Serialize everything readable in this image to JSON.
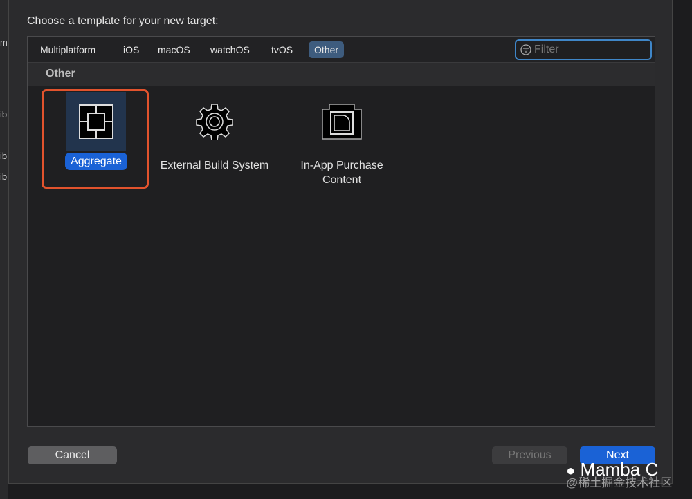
{
  "background_fragments": [
    "m",
    "ib",
    "ib",
    "ib"
  ],
  "dialog": {
    "title": "Choose a template for your new target:",
    "tabs": [
      {
        "label": "Multiplatform"
      },
      {
        "label": "iOS"
      },
      {
        "label": "macOS"
      },
      {
        "label": "watchOS"
      },
      {
        "label": "tvOS"
      },
      {
        "label": "Other",
        "active": true
      }
    ],
    "filter": {
      "placeholder": "Filter",
      "value": ""
    },
    "section_title": "Other",
    "templates": [
      {
        "label": "Aggregate",
        "icon": "aggregate-icon",
        "selected": true
      },
      {
        "label": "External Build System",
        "icon": "gear-icon"
      },
      {
        "label": "In-App Purchase Content",
        "icon": "in-app-purchase-icon"
      }
    ],
    "buttons": {
      "cancel": "Cancel",
      "previous": "Previous",
      "next": "Next"
    }
  },
  "watermark": {
    "name": "Mamba C",
    "source": "@稀土掘金技术社区"
  },
  "colors": {
    "accent": "#1a62d6",
    "highlight": "#e2532d"
  }
}
